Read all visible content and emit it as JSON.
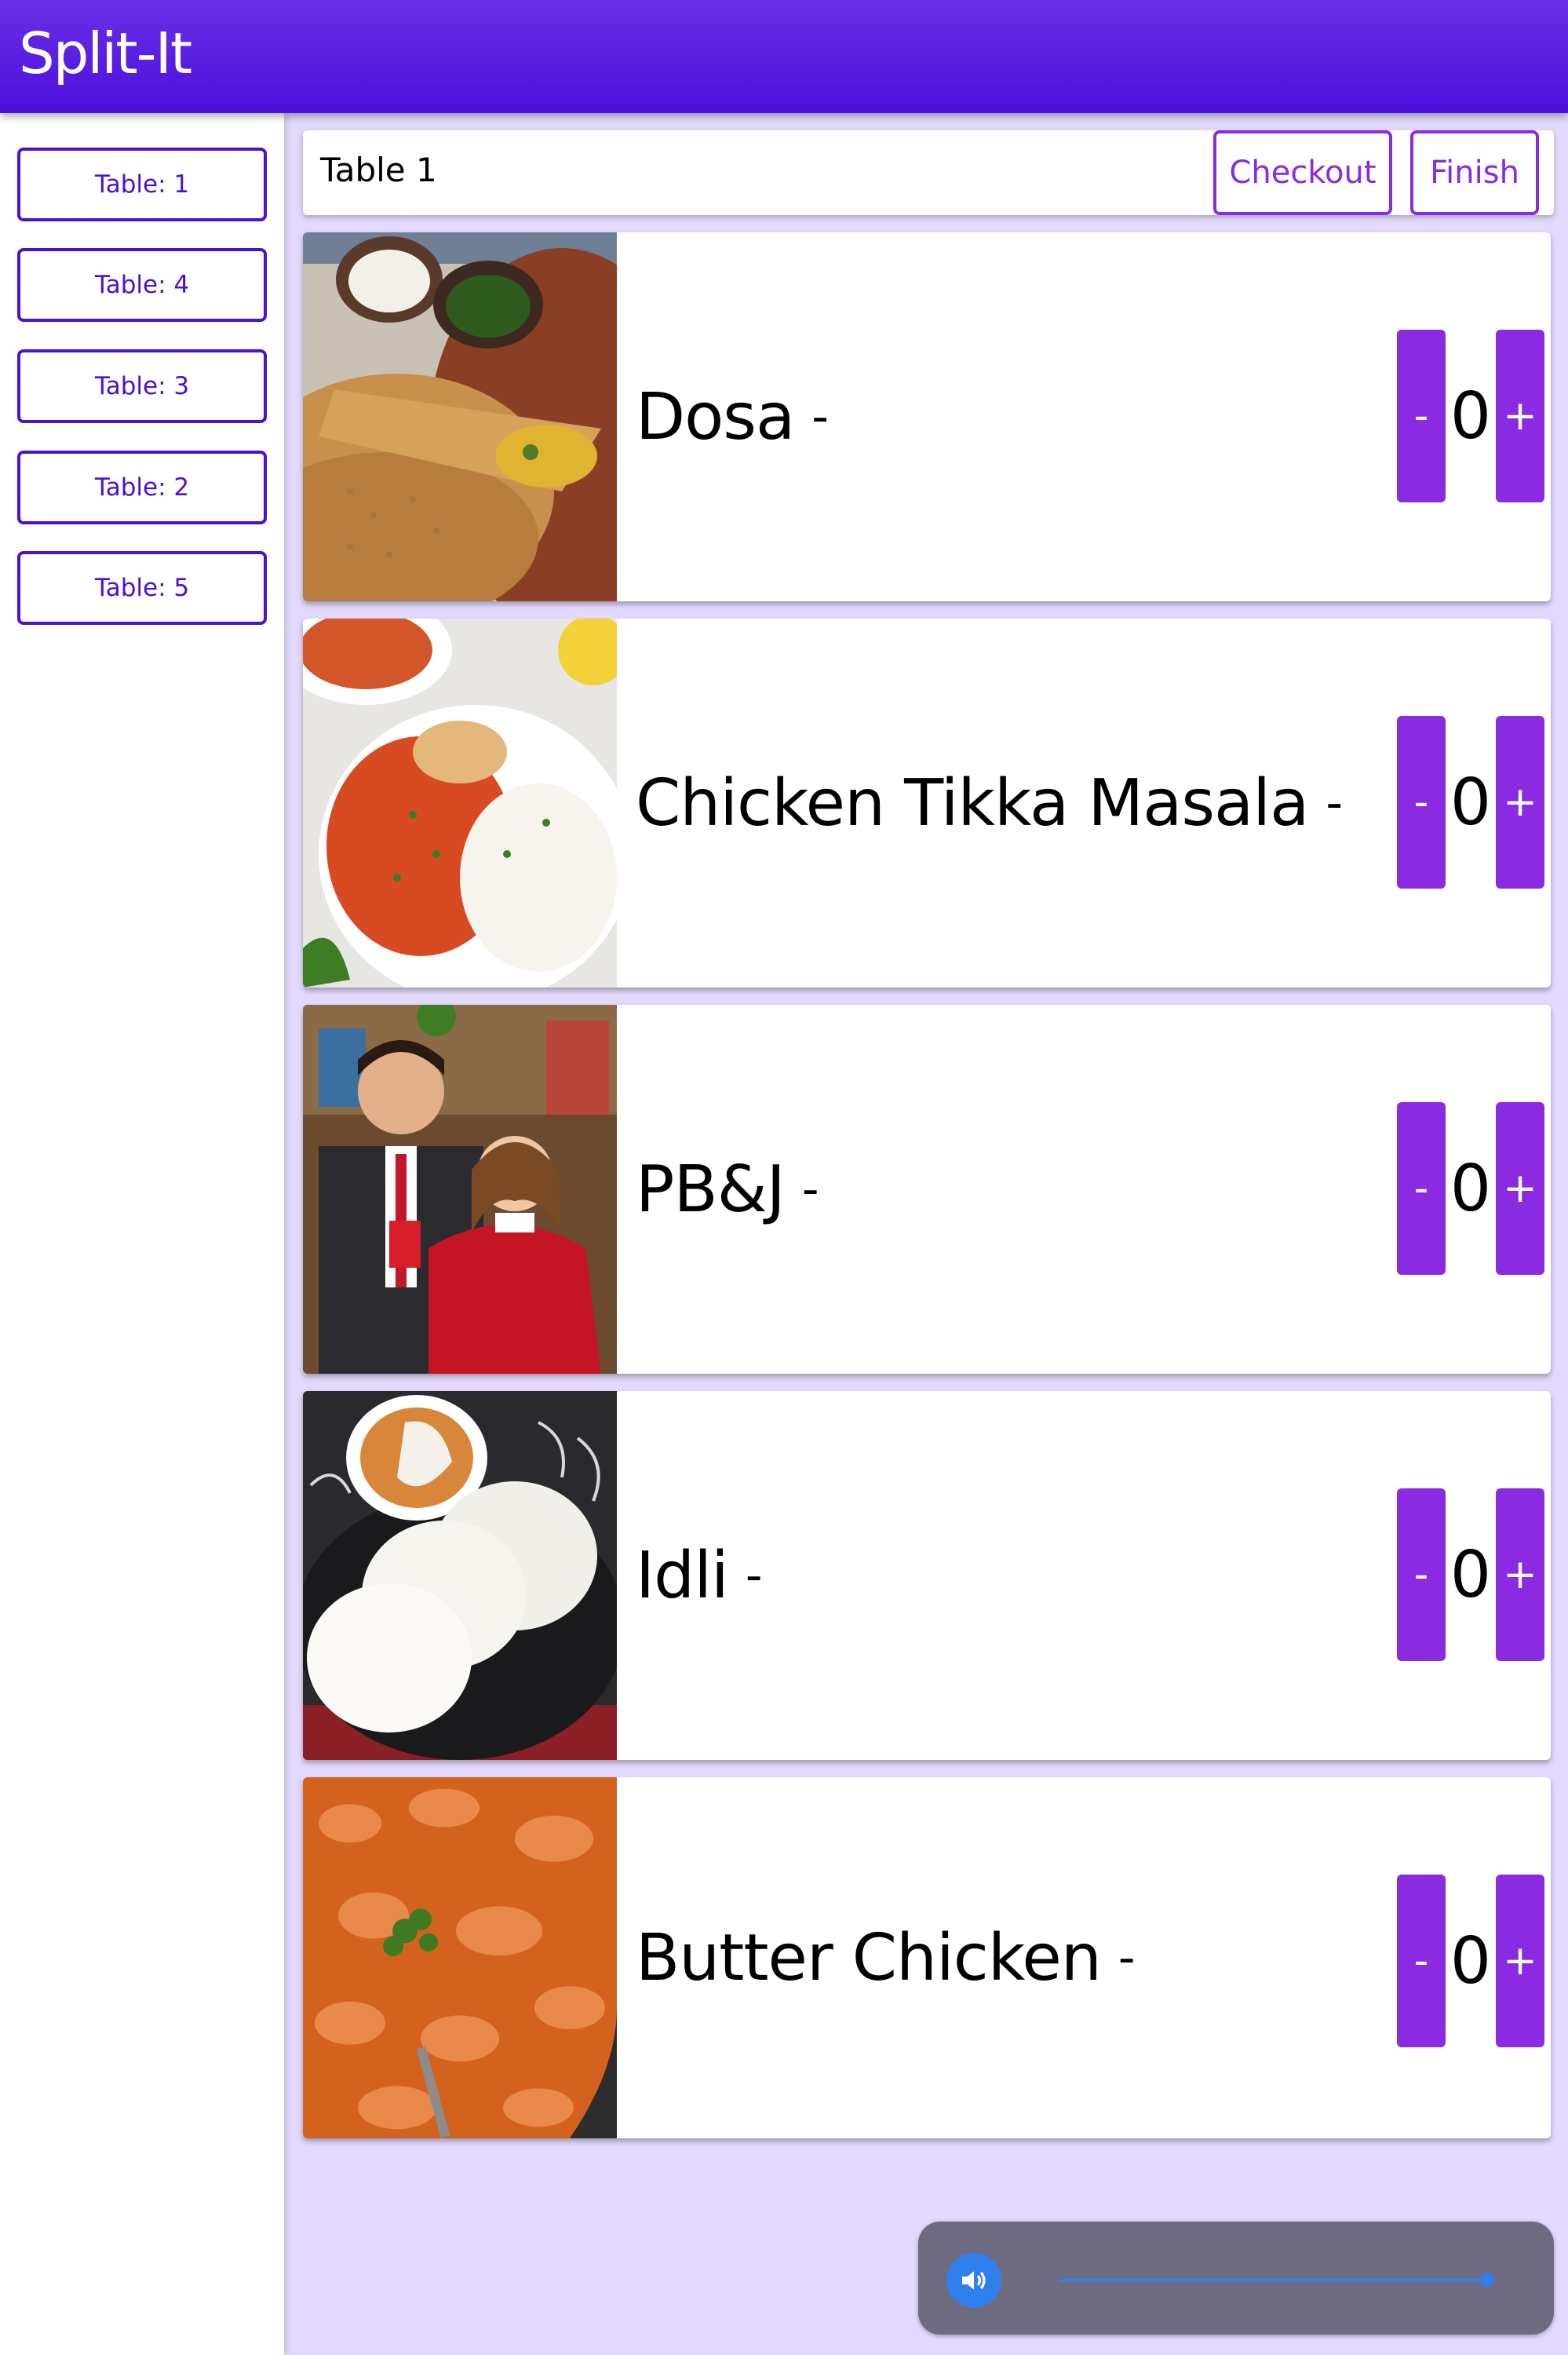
{
  "app": {
    "title": "Split-It"
  },
  "sidebar": {
    "items": [
      {
        "label": "Table: 1"
      },
      {
        "label": "Table: 4"
      },
      {
        "label": "Table: 3"
      },
      {
        "label": "Table: 2"
      },
      {
        "label": "Table: 5"
      }
    ]
  },
  "header": {
    "title": "Table 1",
    "checkout_label": "Checkout",
    "finish_label": "Finish"
  },
  "menu": {
    "separator": "-",
    "minus_label": "-",
    "plus_label": "+",
    "items": [
      {
        "name": "Dosa",
        "count": "0",
        "image": "dosa-photo"
      },
      {
        "name": "Chicken Tikka Masala",
        "count": "0",
        "image": "chicken-tikka-masala-photo"
      },
      {
        "name": "PB&J",
        "count": "0",
        "image": "couple-photo"
      },
      {
        "name": "Idli",
        "count": "0",
        "image": "idli-photo"
      },
      {
        "name": "Butter Chicken",
        "count": "0",
        "image": "butter-chicken-photo"
      }
    ]
  },
  "audio": {
    "icon": "speaker-icon",
    "progress": 1.0
  },
  "colors": {
    "appbar": "#5218e0",
    "accent": "#8a2be2",
    "background": "#e3d9fe"
  }
}
